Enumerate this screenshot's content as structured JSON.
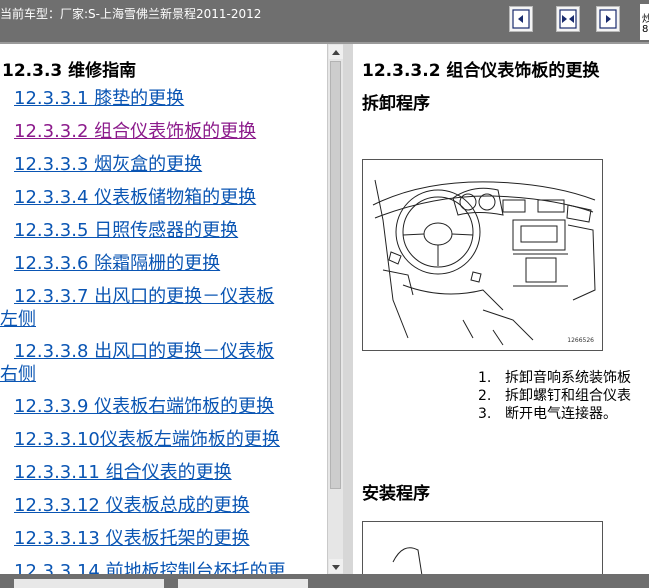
{
  "window": {
    "title": "当前车型：厂家:S-上海雪佛兰新景程2011-2012",
    "edge_fragment": [
      "炒",
      "8"
    ]
  },
  "toolbar": {
    "buttons": [
      {
        "name": "prev-page-button",
        "icon": "arrow-left-icon"
      },
      {
        "name": "toggle-panes-button",
        "icon": "arrows-inward-icon"
      },
      {
        "name": "next-page-button",
        "icon": "arrow-right-icon"
      }
    ]
  },
  "toc": {
    "heading": "12.3.3 维修指南",
    "items": [
      {
        "label": "12.3.3.1 膝垫的更换",
        "visited": false
      },
      {
        "label": "12.3.3.2 组合仪表饰板的更换",
        "visited": true
      },
      {
        "label": "12.3.3.3 烟灰盒的更换",
        "visited": false
      },
      {
        "label": "12.3.3.4 仪表板储物箱的更换",
        "visited": false
      },
      {
        "label": "12.3.3.5 日照传感器的更换",
        "visited": false
      },
      {
        "label": "12.3.3.6 除霜隔栅的更换",
        "visited": false
      },
      {
        "label": "12.3.3.7 出风口的更换－仪表板",
        "label_cont": "左侧",
        "visited": false
      },
      {
        "label": "12.3.3.8 出风口的更换－仪表板",
        "label_cont": "右侧",
        "visited": false
      },
      {
        "label": "12.3.3.9 仪表板右端饰板的更换",
        "visited": false
      },
      {
        "label": "12.3.3.10仪表板左端饰板的更换",
        "visited": false
      },
      {
        "label": "12.3.3.11 组合仪表的更换",
        "visited": false
      },
      {
        "label": "12.3.3.12 仪表板总成的更换",
        "visited": false
      },
      {
        "label": "12.3.3.13 仪表板托架的更换",
        "visited": false
      },
      {
        "label": "12.3.3.14 前地板控制台杯托的更",
        "visited": false
      }
    ]
  },
  "content": {
    "title": "12.3.3.2 组合仪表饰板的更换",
    "removal_heading": "拆卸程序",
    "figure_id": "1266526",
    "steps": [
      {
        "num": "1.",
        "text": "拆卸音响系统装饰板"
      },
      {
        "num": "2.",
        "text": "拆卸螺钉和组合仪表"
      },
      {
        "num": "3.",
        "text": "断开电气连接器。"
      }
    ],
    "install_heading": "安装程序"
  },
  "colors": {
    "titlebar": "#6f6f6f",
    "link": "#0a55b3",
    "visited_link": "#8b1a8b"
  }
}
